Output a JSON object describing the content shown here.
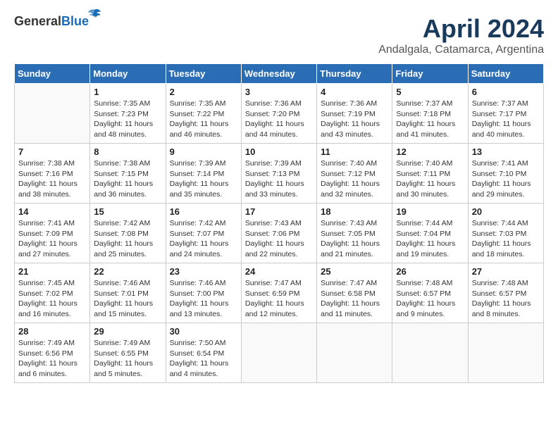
{
  "header": {
    "logo_general": "General",
    "logo_blue": "Blue",
    "month": "April 2024",
    "location": "Andalgala, Catamarca, Argentina"
  },
  "weekdays": [
    "Sunday",
    "Monday",
    "Tuesday",
    "Wednesday",
    "Thursday",
    "Friday",
    "Saturday"
  ],
  "weeks": [
    [
      {
        "day": "",
        "info": ""
      },
      {
        "day": "1",
        "info": "Sunrise: 7:35 AM\nSunset: 7:23 PM\nDaylight: 11 hours\nand 48 minutes."
      },
      {
        "day": "2",
        "info": "Sunrise: 7:35 AM\nSunset: 7:22 PM\nDaylight: 11 hours\nand 46 minutes."
      },
      {
        "day": "3",
        "info": "Sunrise: 7:36 AM\nSunset: 7:20 PM\nDaylight: 11 hours\nand 44 minutes."
      },
      {
        "day": "4",
        "info": "Sunrise: 7:36 AM\nSunset: 7:19 PM\nDaylight: 11 hours\nand 43 minutes."
      },
      {
        "day": "5",
        "info": "Sunrise: 7:37 AM\nSunset: 7:18 PM\nDaylight: 11 hours\nand 41 minutes."
      },
      {
        "day": "6",
        "info": "Sunrise: 7:37 AM\nSunset: 7:17 PM\nDaylight: 11 hours\nand 40 minutes."
      }
    ],
    [
      {
        "day": "7",
        "info": "Sunrise: 7:38 AM\nSunset: 7:16 PM\nDaylight: 11 hours\nand 38 minutes."
      },
      {
        "day": "8",
        "info": "Sunrise: 7:38 AM\nSunset: 7:15 PM\nDaylight: 11 hours\nand 36 minutes."
      },
      {
        "day": "9",
        "info": "Sunrise: 7:39 AM\nSunset: 7:14 PM\nDaylight: 11 hours\nand 35 minutes."
      },
      {
        "day": "10",
        "info": "Sunrise: 7:39 AM\nSunset: 7:13 PM\nDaylight: 11 hours\nand 33 minutes."
      },
      {
        "day": "11",
        "info": "Sunrise: 7:40 AM\nSunset: 7:12 PM\nDaylight: 11 hours\nand 32 minutes."
      },
      {
        "day": "12",
        "info": "Sunrise: 7:40 AM\nSunset: 7:11 PM\nDaylight: 11 hours\nand 30 minutes."
      },
      {
        "day": "13",
        "info": "Sunrise: 7:41 AM\nSunset: 7:10 PM\nDaylight: 11 hours\nand 29 minutes."
      }
    ],
    [
      {
        "day": "14",
        "info": "Sunrise: 7:41 AM\nSunset: 7:09 PM\nDaylight: 11 hours\nand 27 minutes."
      },
      {
        "day": "15",
        "info": "Sunrise: 7:42 AM\nSunset: 7:08 PM\nDaylight: 11 hours\nand 25 minutes."
      },
      {
        "day": "16",
        "info": "Sunrise: 7:42 AM\nSunset: 7:07 PM\nDaylight: 11 hours\nand 24 minutes."
      },
      {
        "day": "17",
        "info": "Sunrise: 7:43 AM\nSunset: 7:06 PM\nDaylight: 11 hours\nand 22 minutes."
      },
      {
        "day": "18",
        "info": "Sunrise: 7:43 AM\nSunset: 7:05 PM\nDaylight: 11 hours\nand 21 minutes."
      },
      {
        "day": "19",
        "info": "Sunrise: 7:44 AM\nSunset: 7:04 PM\nDaylight: 11 hours\nand 19 minutes."
      },
      {
        "day": "20",
        "info": "Sunrise: 7:44 AM\nSunset: 7:03 PM\nDaylight: 11 hours\nand 18 minutes."
      }
    ],
    [
      {
        "day": "21",
        "info": "Sunrise: 7:45 AM\nSunset: 7:02 PM\nDaylight: 11 hours\nand 16 minutes."
      },
      {
        "day": "22",
        "info": "Sunrise: 7:46 AM\nSunset: 7:01 PM\nDaylight: 11 hours\nand 15 minutes."
      },
      {
        "day": "23",
        "info": "Sunrise: 7:46 AM\nSunset: 7:00 PM\nDaylight: 11 hours\nand 13 minutes."
      },
      {
        "day": "24",
        "info": "Sunrise: 7:47 AM\nSunset: 6:59 PM\nDaylight: 11 hours\nand 12 minutes."
      },
      {
        "day": "25",
        "info": "Sunrise: 7:47 AM\nSunset: 6:58 PM\nDaylight: 11 hours\nand 11 minutes."
      },
      {
        "day": "26",
        "info": "Sunrise: 7:48 AM\nSunset: 6:57 PM\nDaylight: 11 hours\nand 9 minutes."
      },
      {
        "day": "27",
        "info": "Sunrise: 7:48 AM\nSunset: 6:57 PM\nDaylight: 11 hours\nand 8 minutes."
      }
    ],
    [
      {
        "day": "28",
        "info": "Sunrise: 7:49 AM\nSunset: 6:56 PM\nDaylight: 11 hours\nand 6 minutes."
      },
      {
        "day": "29",
        "info": "Sunrise: 7:49 AM\nSunset: 6:55 PM\nDaylight: 11 hours\nand 5 minutes."
      },
      {
        "day": "30",
        "info": "Sunrise: 7:50 AM\nSunset: 6:54 PM\nDaylight: 11 hours\nand 4 minutes."
      },
      {
        "day": "",
        "info": ""
      },
      {
        "day": "",
        "info": ""
      },
      {
        "day": "",
        "info": ""
      },
      {
        "day": "",
        "info": ""
      }
    ]
  ]
}
